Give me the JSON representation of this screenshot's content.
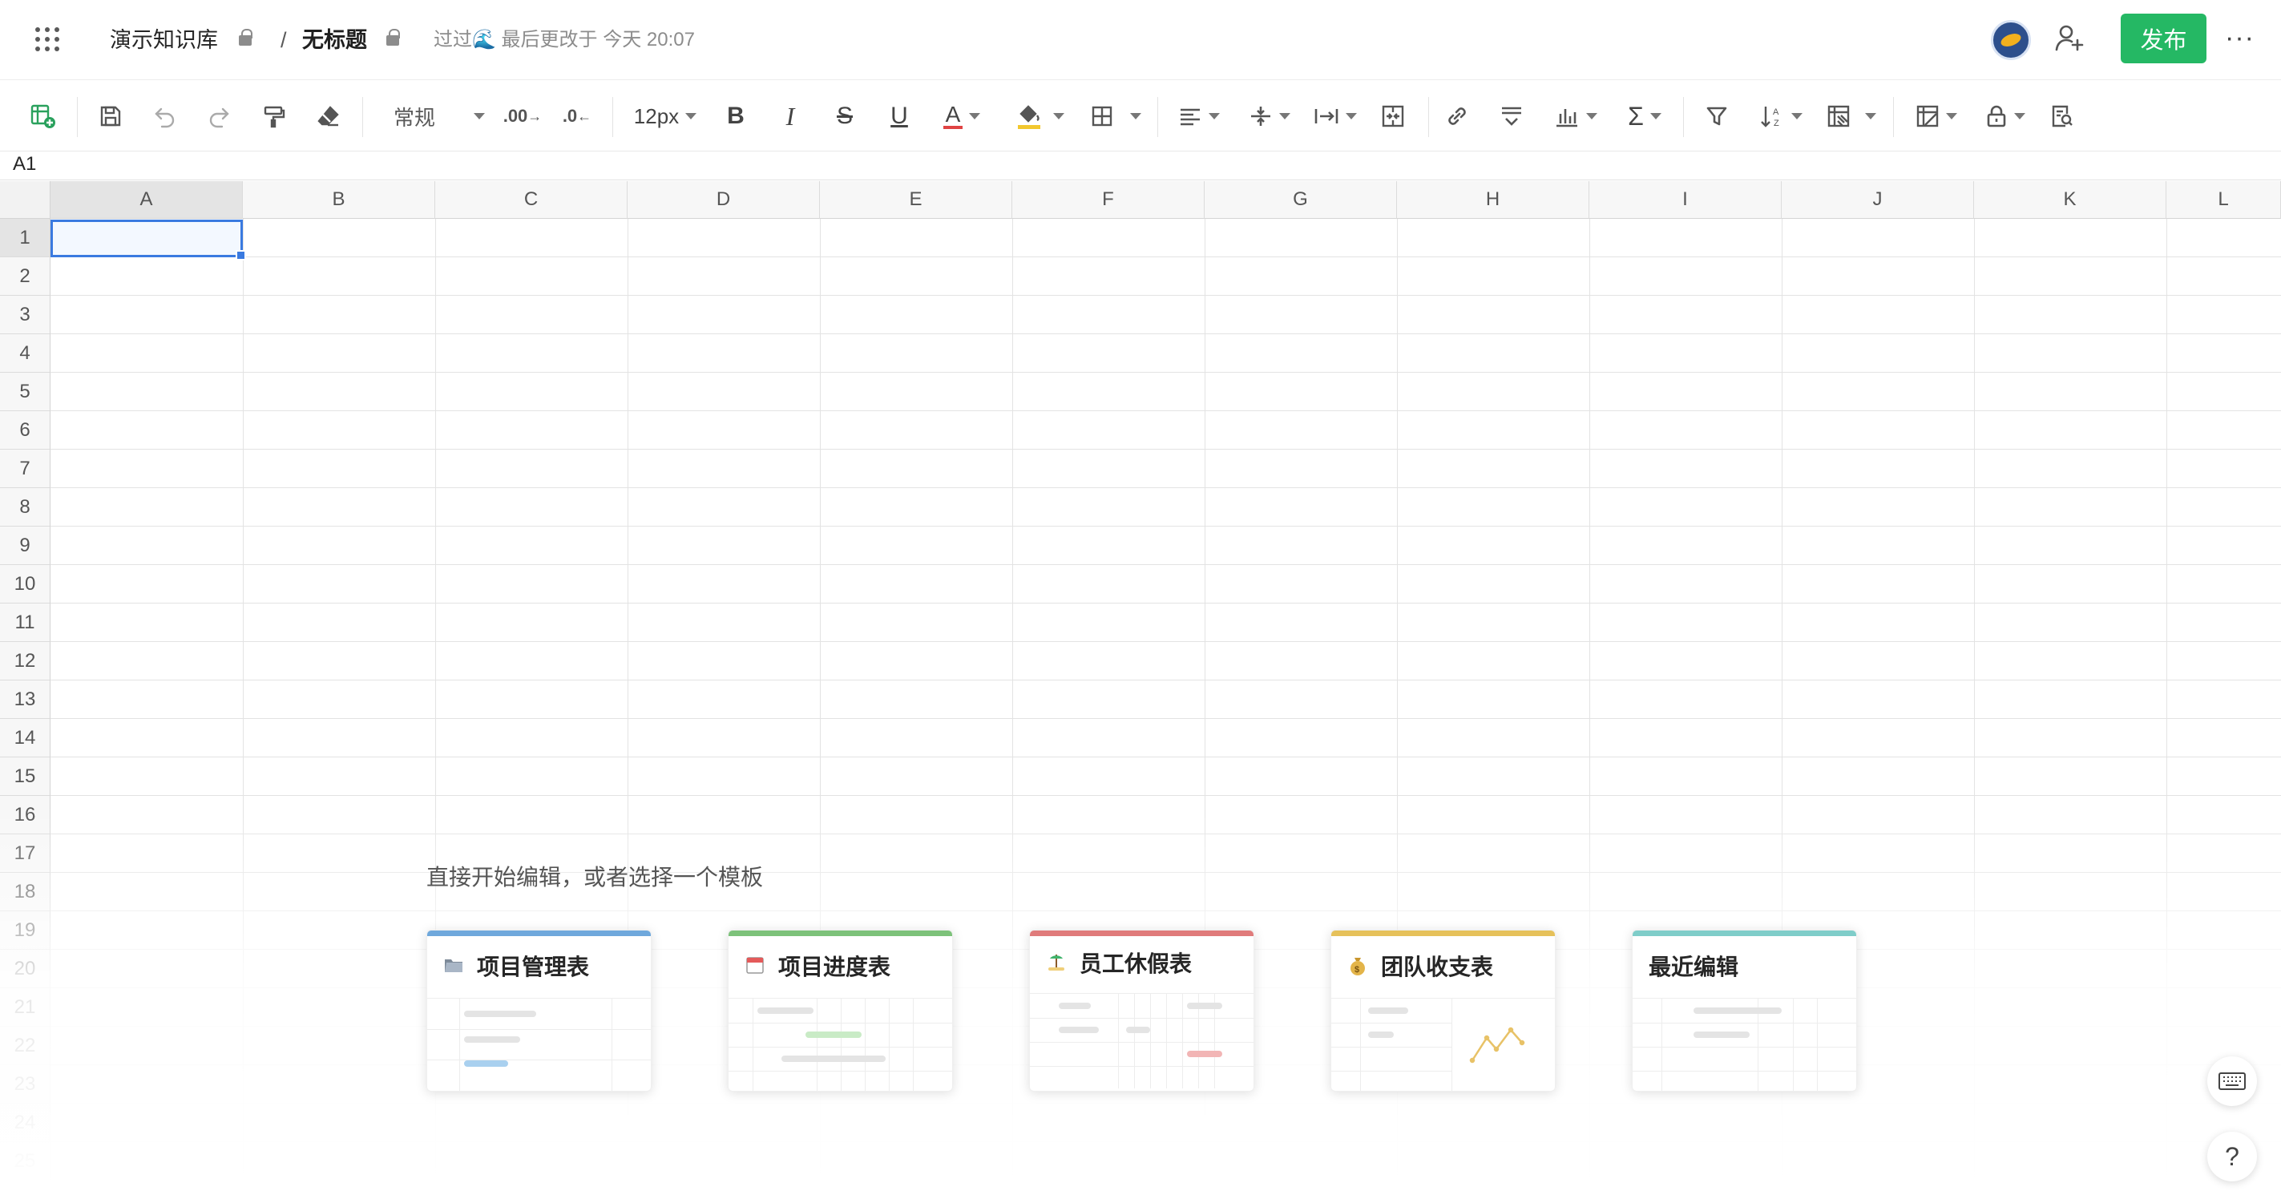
{
  "header": {
    "breadcrumb_root": "演示知识库",
    "breadcrumb_separator": "/",
    "doc_title": "无标题",
    "edit_status": "过过🌊 最后更改于 今天 20:07",
    "publish_label": "发布",
    "more_label": "···"
  },
  "toolbar": {
    "number_format": "常规",
    "font_size": "12px",
    "icons": [
      "new-sheet-icon",
      "save-icon",
      "undo-icon",
      "redo-icon",
      "format-painter-icon",
      "clear-format-icon",
      "decrease-decimal-icon",
      "increase-decimal-icon",
      "bold-icon",
      "italic-icon",
      "strikethrough-icon",
      "underline-icon",
      "font-color-icon",
      "fill-color-icon",
      "borders-icon",
      "align-icon",
      "vertical-align-icon",
      "text-wrap-icon",
      "merge-cells-icon",
      "link-icon",
      "freeze-icon",
      "chart-icon",
      "formula-icon",
      "filter-icon",
      "sort-icon",
      "conditional-format-icon",
      "table-style-icon",
      "protect-icon",
      "find-icon"
    ]
  },
  "formula_bar": {
    "cell_ref": "A1"
  },
  "sheet": {
    "columns": [
      "A",
      "B",
      "C",
      "D",
      "E",
      "F",
      "G",
      "H",
      "I",
      "J",
      "K",
      "L"
    ],
    "rows": [
      "1",
      "2",
      "3",
      "4",
      "5",
      "6",
      "7",
      "8",
      "9",
      "10",
      "11",
      "12",
      "13",
      "14",
      "15",
      "16",
      "17",
      "18",
      "19",
      "20",
      "21",
      "22",
      "23",
      "24",
      "25"
    ],
    "selected_cell": "A1"
  },
  "templates": {
    "title": "直接开始编辑，或者选择一个模板",
    "cards": [
      {
        "name": "项目管理表",
        "icon": "folder-icon",
        "color": "#6fa8dc"
      },
      {
        "name": "项目进度表",
        "icon": "calendar-icon",
        "color": "#7dc27a"
      },
      {
        "name": "员工休假表",
        "icon": "beach-icon",
        "color": "#e07b7b"
      },
      {
        "name": "团队收支表",
        "icon": "money-bag-icon",
        "color": "#e6c15a"
      },
      {
        "name": "最近编辑",
        "icon": "",
        "color": "#7fcdc9"
      }
    ]
  },
  "colors": {
    "accent": "#3a7ae0",
    "publish": "#25b864"
  }
}
